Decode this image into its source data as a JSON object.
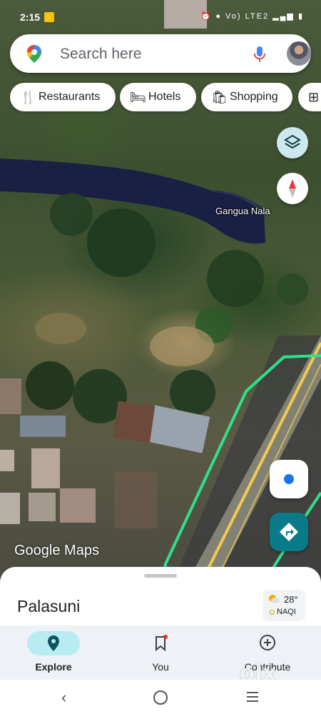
{
  "status_bar": {
    "time": "2:15",
    "indicators": "Vo) LTE2"
  },
  "search": {
    "placeholder": "Search here"
  },
  "chips": [
    {
      "label": "Restaurants",
      "icon": "fork-knife-icon"
    },
    {
      "label": "Hotels",
      "icon": "bed-icon"
    },
    {
      "label": "Shopping",
      "icon": "shopping-bag-icon"
    },
    {
      "label": "",
      "icon": "plus-square-icon"
    }
  ],
  "map": {
    "labels": [
      "Gangua Nala"
    ],
    "logo": "Google Maps",
    "view": "satellite"
  },
  "sheet": {
    "place_name": "Palasuni",
    "weather": {
      "temperature": "28°",
      "air_quality": "NAQI"
    }
  },
  "bottom_nav": {
    "items": [
      {
        "label": "Explore",
        "active": true
      },
      {
        "label": "You",
        "active": false
      },
      {
        "label": "Contribute",
        "active": false
      }
    ]
  },
  "watermark": "olx",
  "colors": {
    "accent_teal": "#0b7a88",
    "explore_pill": "#b8ecf3",
    "route_green": "#2fe08a",
    "road_yellow": "#f2c94c"
  }
}
